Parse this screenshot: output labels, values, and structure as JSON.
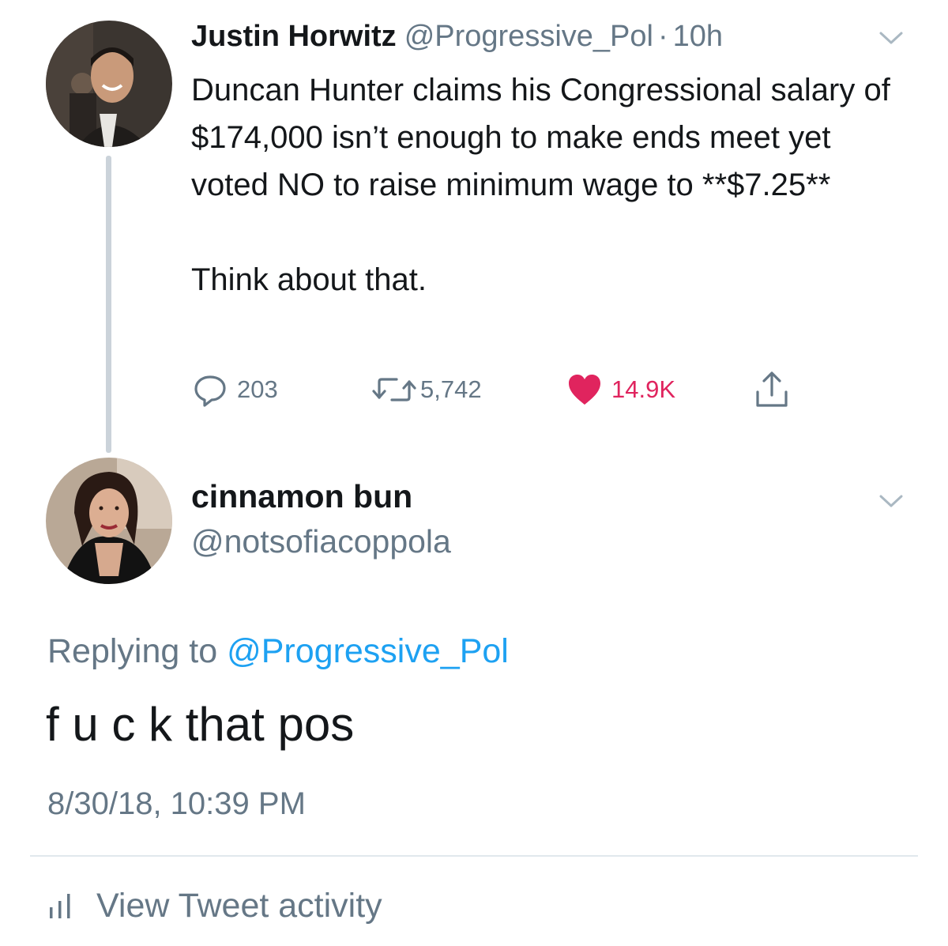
{
  "original_tweet": {
    "author_name": "Justin Horwitz",
    "author_handle": "@Progressive_Pol",
    "time_separator": "·",
    "age": "10h",
    "avatar_icon": "user-avatar-photo",
    "text": "Duncan Hunter claims his Congressional salary of $174,000 isn’t enough to make ends meet yet voted NO to raise minimum wage to **$7.25**\n\nThink about that.",
    "actions": {
      "reply_count": "203",
      "retweet_count": "5,742",
      "like_count": "14.9K",
      "reply_icon": "comment-bubble-icon",
      "retweet_icon": "retweet-icon",
      "like_icon": "heart-icon",
      "share_icon": "share-upload-icon"
    }
  },
  "reply_tweet": {
    "author_name": "cinnamon bun",
    "author_handle": "@notsofiacoppola",
    "avatar_icon": "user-avatar-photo",
    "replying_to_prefix": "Replying to",
    "replying_to_handle": "@Progressive_Pol",
    "text": "f u c k that pos",
    "timestamp": "8/30/18, 10:39 PM"
  },
  "footer": {
    "activity_label": "View Tweet activity",
    "activity_icon": "bar-chart-icon"
  },
  "colors": {
    "text": "#14171a",
    "muted": "#657786",
    "link": "#1da1f2",
    "like": "#e0245e",
    "thread_line": "#cbd3da",
    "divider": "#e1e8ed"
  }
}
